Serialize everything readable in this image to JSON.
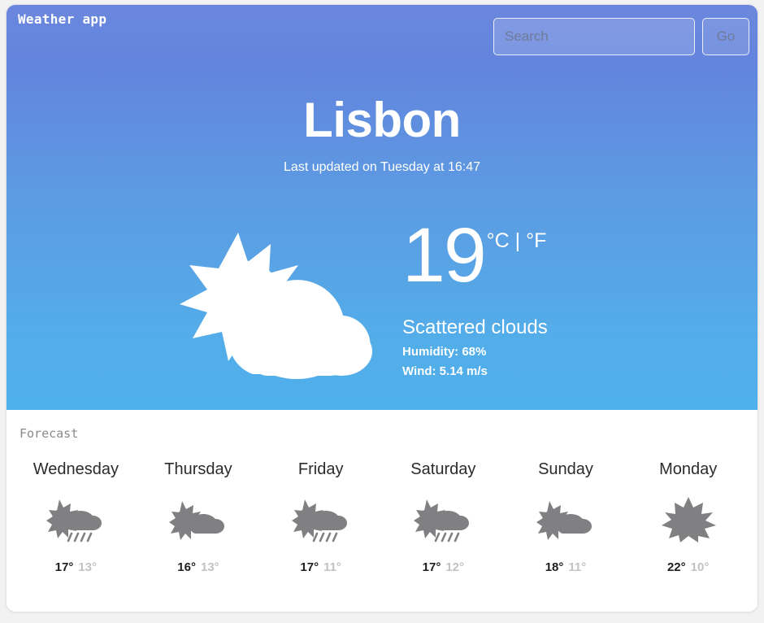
{
  "header": {
    "app_title": "Weather app",
    "search": {
      "placeholder": "Search",
      "value": "",
      "go_label": "Go"
    }
  },
  "current": {
    "city": "Lisbon",
    "last_updated": "Last updated on Tuesday at 16:47",
    "icon": "sun-behind-cloud-icon",
    "temperature": "19",
    "units": "°C | °F",
    "condition": "Scattered clouds",
    "humidity": "Humidity: 68%",
    "wind": "Wind: 5.14 m/s"
  },
  "forecast": {
    "label": "Forecast",
    "days": [
      {
        "day": "Wednesday",
        "icon": "sun-cloud-rain-icon",
        "max": "17°",
        "min": "13°"
      },
      {
        "day": "Thursday",
        "icon": "sun-behind-cloud-icon",
        "max": "16°",
        "min": "13°"
      },
      {
        "day": "Friday",
        "icon": "sun-cloud-rain-icon",
        "max": "17°",
        "min": "11°"
      },
      {
        "day": "Saturday",
        "icon": "sun-cloud-rain-icon",
        "max": "17°",
        "min": "12°"
      },
      {
        "day": "Sunday",
        "icon": "sun-behind-cloud-icon",
        "max": "18°",
        "min": "11°"
      },
      {
        "day": "Monday",
        "icon": "sun-icon",
        "max": "22°",
        "min": "10°"
      }
    ]
  },
  "colors": {
    "gradient_top": "#6b87dd",
    "gradient_bottom": "#4fb0ea",
    "card_background": "#ffffff",
    "page_background": "#f2f2f3",
    "temp_max_text": "#1d1d20",
    "temp_min_text": "#c2c2c5",
    "forecast_icon": "#808083"
  }
}
